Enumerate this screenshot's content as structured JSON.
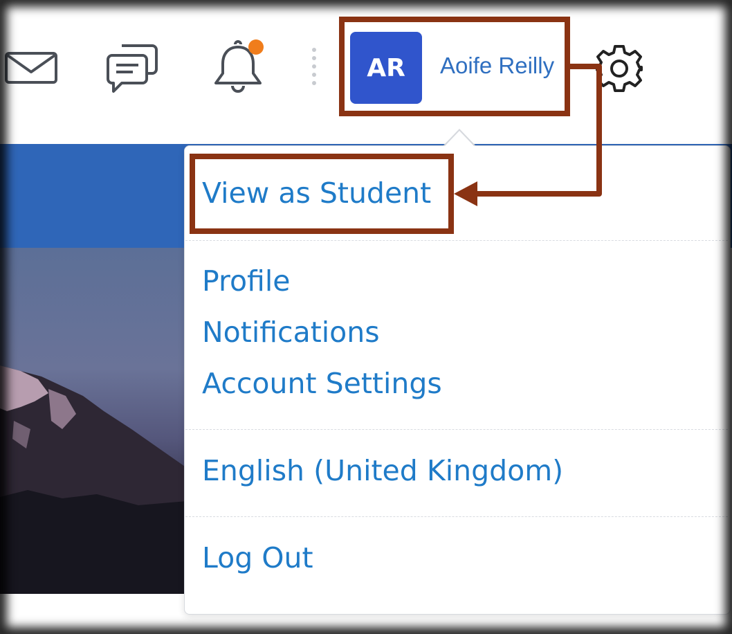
{
  "header": {
    "icons": [
      {
        "name": "mail-icon"
      },
      {
        "name": "chat-icon"
      },
      {
        "name": "bell-icon",
        "badge_color": "#f07d1c"
      },
      {
        "name": "gear-icon"
      }
    ],
    "user": {
      "initials": "AR",
      "name": "Aoife Reilly",
      "avatar_color": "#3055cc"
    }
  },
  "user_menu": {
    "items": [
      {
        "label": "View as Student"
      },
      {
        "label": "Profile"
      },
      {
        "label": "Notifications"
      },
      {
        "label": "Account Settings"
      },
      {
        "label": "English (United Kingdom)"
      },
      {
        "label": "Log Out"
      }
    ],
    "link_color": "#1f7bc8"
  },
  "annotation": {
    "color": "#8a3313"
  }
}
